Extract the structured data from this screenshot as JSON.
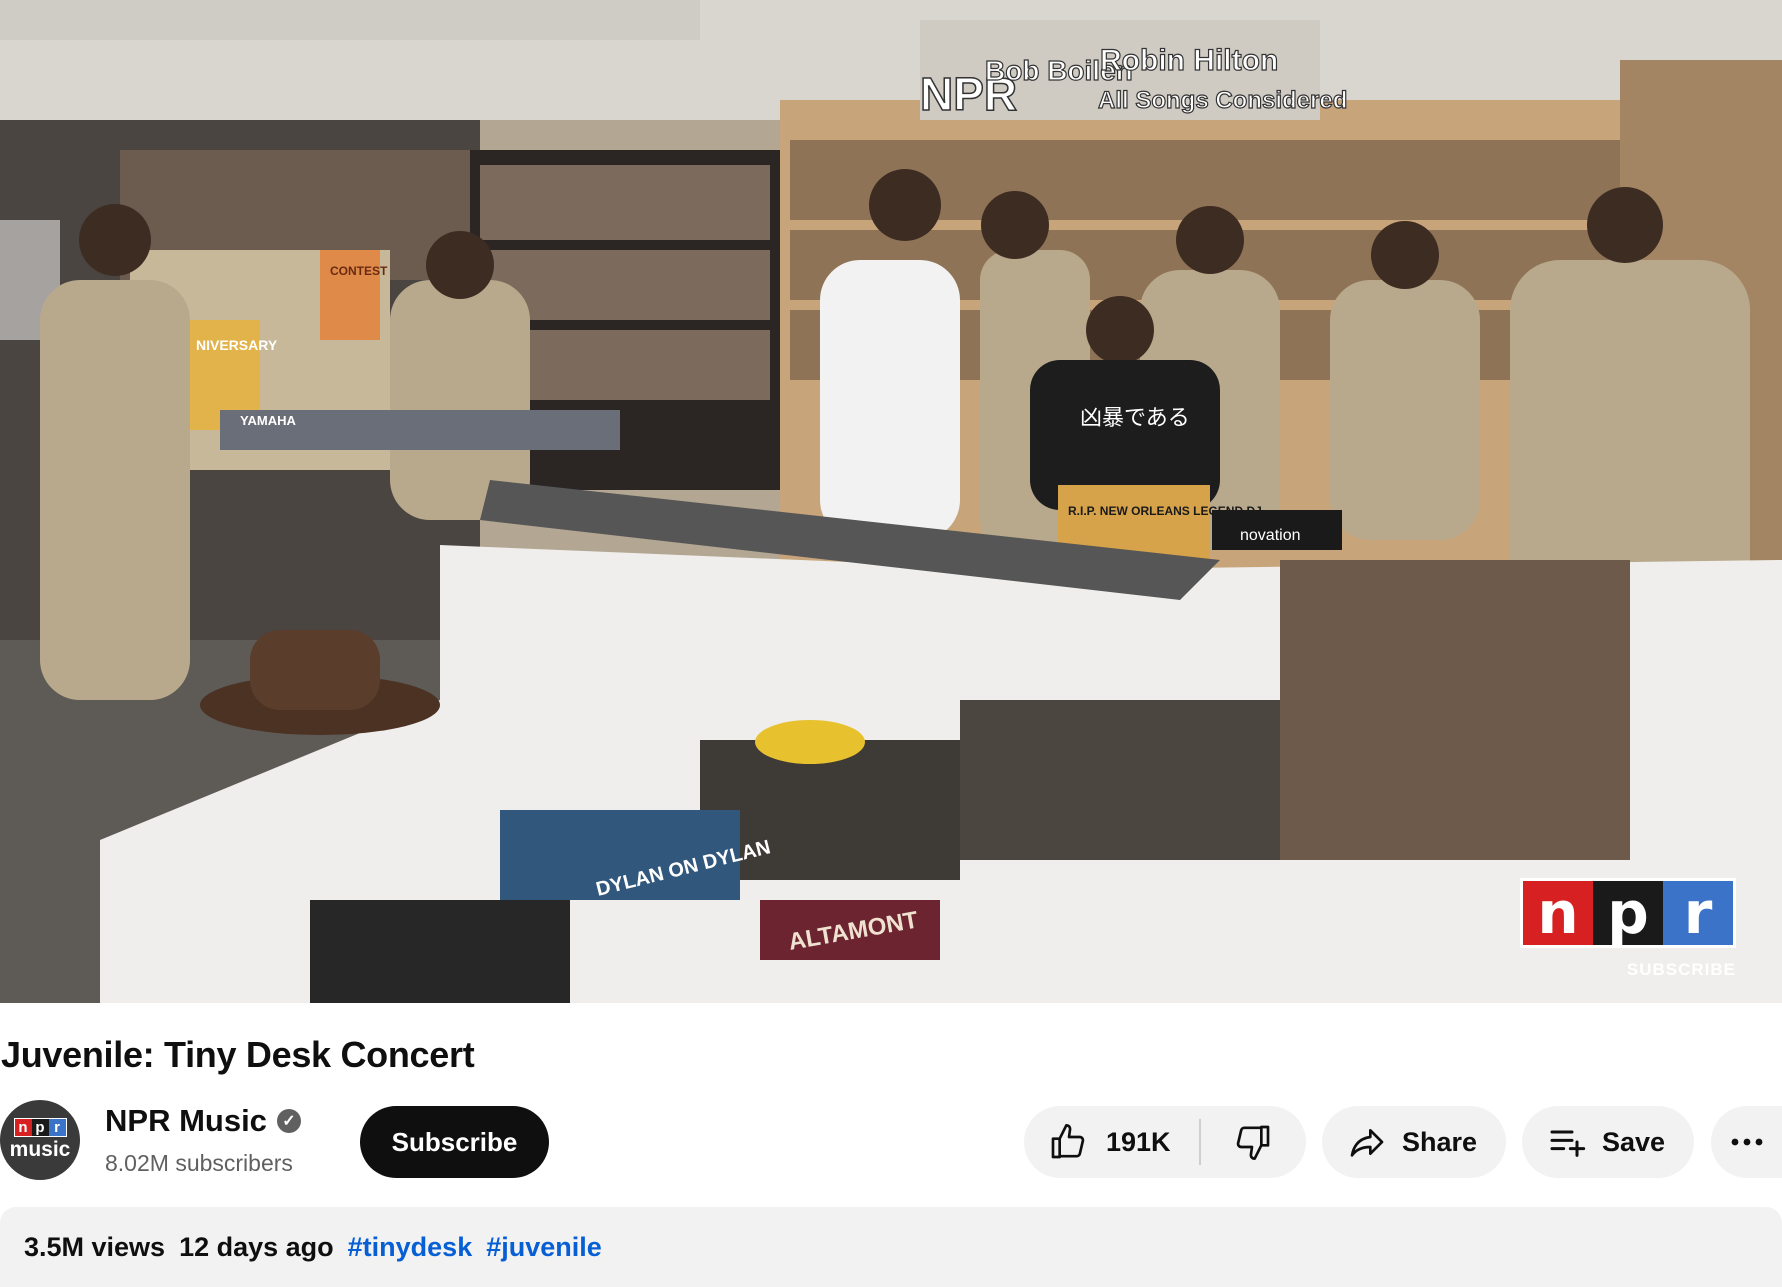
{
  "video": {
    "overlay_logo": {
      "n": "n",
      "p": "p",
      "r": "r"
    },
    "overlay_subscribe": "SUBSCRIBE",
    "scene_text": {
      "wall_npr": "NPR",
      "wall_bob": "Bob Boilen",
      "wall_robin": "Robin Hilton",
      "wall_allsongs": "All Songs Considered",
      "keyboard_brand": "YAMAHA",
      "rip_sign": "R.I.P. NEW ORLEANS LEGEND DJ",
      "shirt_text": "凶暴である",
      "controller_brand": "novation",
      "book_dylan": "DYLAN ON DYLAN",
      "book_altamont": "ALTAMONT",
      "poster_contest": "CONTEST",
      "poster_anniversary": "NIVERSARY"
    }
  },
  "title": "Juvenile: Tiny Desk Concert",
  "channel": {
    "avatar_logo": {
      "n": "n",
      "p": "p",
      "r": "r"
    },
    "avatar_text": "music",
    "name": "NPR Music",
    "verified_icon": "check-circle-icon",
    "subscribers": "8.02M subscribers"
  },
  "actions": {
    "subscribe": "Subscribe",
    "like_count": "191K",
    "share": "Share",
    "save": "Save",
    "icons": [
      "thumbs-up-icon",
      "thumbs-down-icon",
      "share-arrow-icon",
      "playlist-add-icon",
      "more-horizontal-icon"
    ]
  },
  "description": {
    "views": "3.5M views",
    "date": "12 days ago",
    "hashtags": [
      "#tinydesk",
      "#juvenile"
    ]
  },
  "colors": {
    "npr_red": "#d62021",
    "npr_black": "#1a1a1a",
    "npr_blue": "#3b73c9",
    "hashtag_blue": "#065fd4",
    "pill_bg": "#f2f2f2"
  }
}
